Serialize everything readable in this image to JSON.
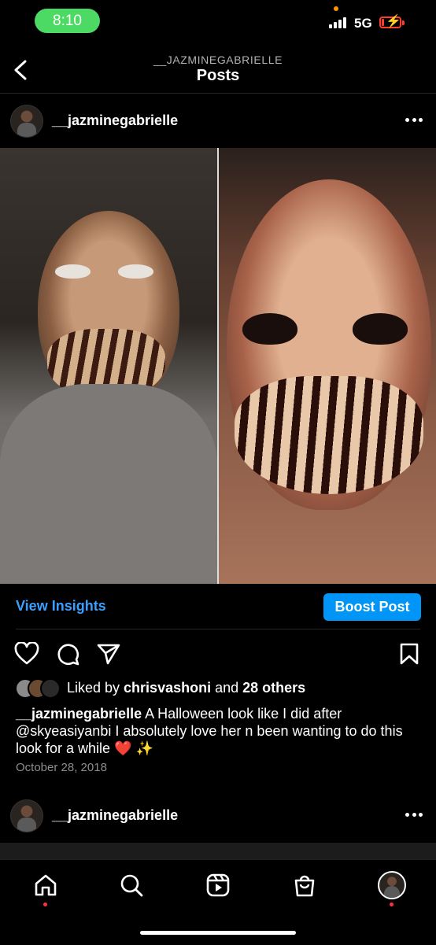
{
  "status_bar": {
    "time": "8:10",
    "network": "5G",
    "battery_level": 0.15
  },
  "header": {
    "username": "__JAZMINEGABRIELLE",
    "title": "Posts"
  },
  "post": {
    "username": "__jazminegabrielle",
    "insights_label": "View Insights",
    "boost_label": "Boost Post",
    "likes": {
      "prefix": "Liked by ",
      "user": "chrisvashoni",
      "middle": " and ",
      "others": "28 others"
    },
    "caption": {
      "user": "__jazminegabrielle",
      "text": " A Halloween look like I did after @skyeasiyanbi I absolutely love her n been wanting to do this look for a while ❤️ ✨"
    },
    "date": "October 28, 2018"
  },
  "next_post": {
    "username": "__jazminegabrielle"
  },
  "bottom_nav": {
    "items": [
      "home-icon",
      "search-icon",
      "reels-icon",
      "shop-icon",
      "profile-avatar"
    ]
  },
  "colors": {
    "accent": "#0095f6",
    "link": "#3aa0ff",
    "status_green": "#4cd964",
    "notification": "#ff3040"
  }
}
